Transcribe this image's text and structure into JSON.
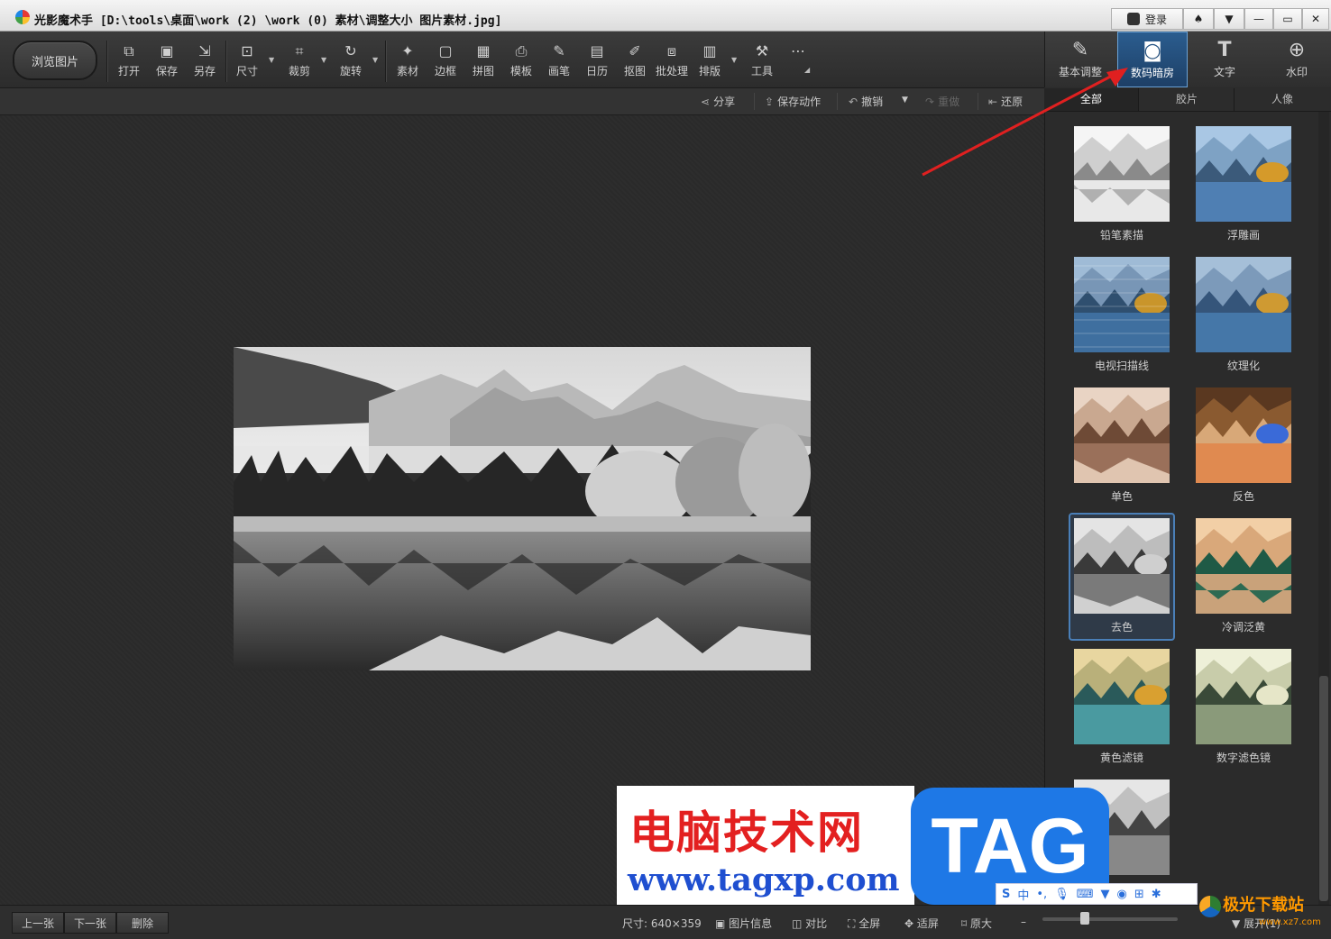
{
  "window": {
    "title": "光影魔术手 [D:\\tools\\桌面\\work (2) \\work (0) 素材\\调整大小 图片素材.jpg]",
    "login_label": "登录"
  },
  "toolbar": {
    "browse_label": "浏览图片",
    "tools": [
      {
        "label": "打开",
        "icon": "open-icon"
      },
      {
        "label": "保存",
        "icon": "save-icon"
      },
      {
        "label": "另存",
        "icon": "save-as-icon"
      },
      {
        "label": "尺寸",
        "icon": "resize-icon"
      },
      {
        "label": "裁剪",
        "icon": "crop-icon"
      },
      {
        "label": "旋转",
        "icon": "rotate-icon"
      },
      {
        "label": "素材",
        "icon": "material-icon"
      },
      {
        "label": "边框",
        "icon": "border-icon"
      },
      {
        "label": "拼图",
        "icon": "collage-icon"
      },
      {
        "label": "模板",
        "icon": "template-icon"
      },
      {
        "label": "画笔",
        "icon": "brush-icon"
      },
      {
        "label": "日历",
        "icon": "calendar-icon"
      },
      {
        "label": "抠图",
        "icon": "cutout-icon"
      },
      {
        "label": "批处理",
        "icon": "batch-icon"
      },
      {
        "label": "排版",
        "icon": "layout-icon"
      },
      {
        "label": "工具",
        "icon": "wrench-icon"
      }
    ]
  },
  "subbar": {
    "share": "分享",
    "save_action": "保存动作",
    "undo": "撤销",
    "redo": "重做",
    "restore": "还原"
  },
  "right_tabs": [
    {
      "label": "基本调整",
      "icon": "basic-adjust-icon"
    },
    {
      "label": "数码暗房",
      "icon": "darkroom-icon"
    },
    {
      "label": "文字",
      "icon": "text-icon"
    },
    {
      "label": "水印",
      "icon": "watermark-icon"
    }
  ],
  "categories": [
    "全部",
    "胶片",
    "人像"
  ],
  "effects": [
    {
      "label": "铅笔素描"
    },
    {
      "label": "浮雕画"
    },
    {
      "label": "电视扫描线"
    },
    {
      "label": "纹理化"
    },
    {
      "label": "单色"
    },
    {
      "label": "反色"
    },
    {
      "label": "去色"
    },
    {
      "label": "冷调泛黄"
    },
    {
      "label": "黄色滤镜"
    },
    {
      "label": "数字滤色镜"
    }
  ],
  "selected_effect": "去色",
  "statusbar": {
    "prev": "上一张",
    "next": "下一张",
    "delete": "删除",
    "size": "尺寸: 640×359",
    "info": "图片信息",
    "compare": "对比",
    "fullscreen": "全屏",
    "fit": "适屏",
    "original": "原大",
    "expand": "展开(1)"
  },
  "overlay": {
    "site_name": "电脑技术网",
    "site_url": "www.tagxp.com",
    "tag": "TAG",
    "corner_name": "极光下载站",
    "corner_url": "www.xz7.com",
    "ime_label": "中"
  },
  "colors": {
    "accent": "#2b5d8f",
    "arrow": "#e02020"
  }
}
